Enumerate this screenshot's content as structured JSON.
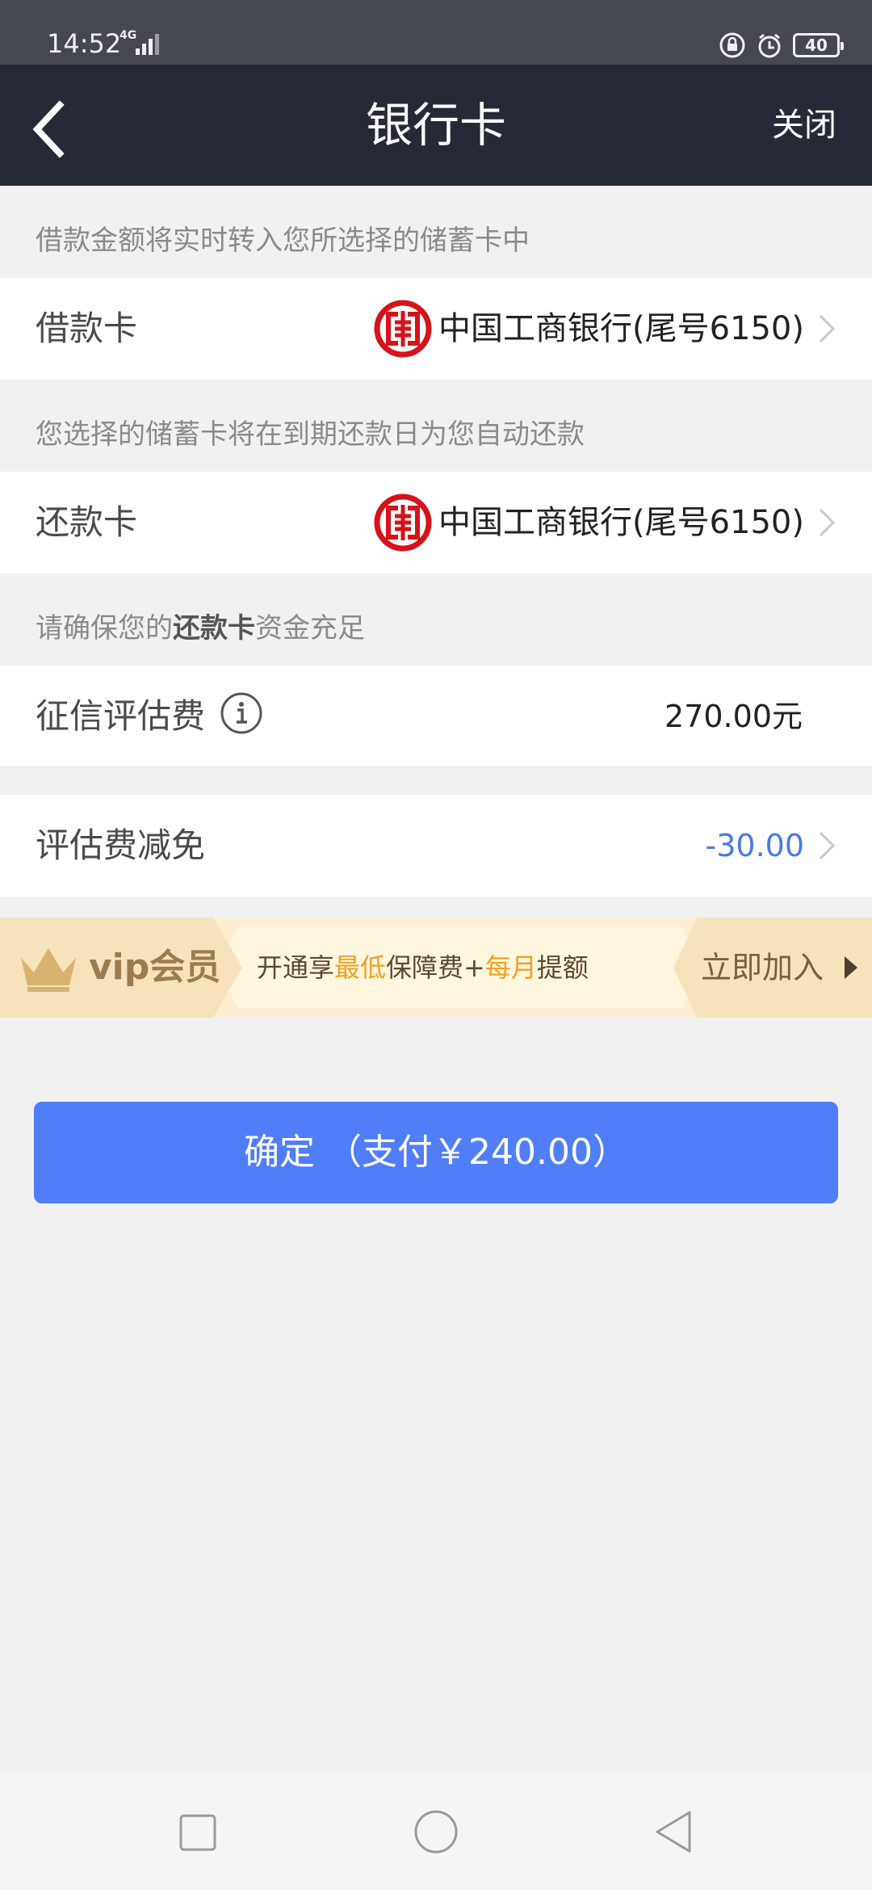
{
  "status_bar": {
    "time": "14:52",
    "network": "4G",
    "battery": "40"
  },
  "nav": {
    "title": "银行卡",
    "close": "关闭"
  },
  "loan_card_section": {
    "hint": "借款金额将实时转入您所选择的储蓄卡中",
    "label": "借款卡",
    "bank": "中国工商银行(尾号6150)"
  },
  "repay_card_section": {
    "hint": "您选择的储蓄卡将在到期还款日为您自动还款",
    "label": "还款卡",
    "bank": "中国工商银行(尾号6150)"
  },
  "fund_notice": {
    "prefix": "请确保您的",
    "bold": "还款卡",
    "suffix": "资金充足"
  },
  "fee": {
    "label": "征信评估费",
    "value": "270.00元"
  },
  "waiver": {
    "label": "评估费减免",
    "value": "-30.00"
  },
  "vip_banner": {
    "title": "vip会员",
    "text_1": "开通享",
    "text_hl_1": "最低",
    "text_2": "保障费+",
    "text_hl_2": "每月",
    "text_3": "提额",
    "join": "立即加入"
  },
  "confirm_button": {
    "label": "确定 （支付￥240.00）"
  },
  "colors": {
    "nav_bg": "#262a37",
    "status_bg": "#454850",
    "accent_blue": "#4f7ef8",
    "waiver_blue": "#4a7ae8",
    "icbc_red": "#d7121a",
    "vip_highlight": "#f2a020"
  },
  "icons": {
    "back": "back-arrow-icon",
    "bank_logo": "icbc-logo-icon",
    "chevron": "chevron-right-icon",
    "info": "info-icon",
    "crown": "crown-icon"
  }
}
